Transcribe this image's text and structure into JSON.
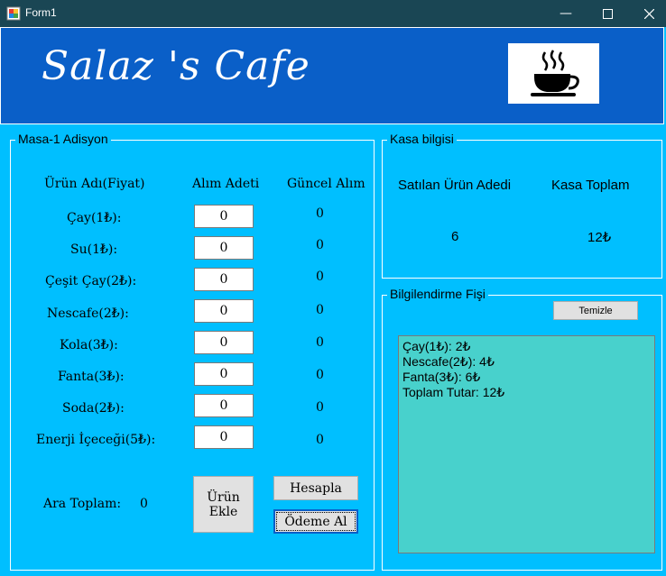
{
  "window": {
    "title": "Form1"
  },
  "header": {
    "brand": "Salaz 's Cafe"
  },
  "order": {
    "group_title": "Masa-1 Adisyon",
    "headers": {
      "product": "Ürün Adı(Fiyat)",
      "qty": "Alım Adeti",
      "current": "Güncel Alım"
    },
    "items": [
      {
        "name": "Çay(1₺):",
        "qty": "0",
        "current": "0"
      },
      {
        "name": "Su(1₺):",
        "qty": "0",
        "current": "0"
      },
      {
        "name": "Çeşit Çay(2₺):",
        "qty": "0",
        "current": "0"
      },
      {
        "name": "Nescafe(2₺):",
        "qty": "0",
        "current": "0"
      },
      {
        "name": "Kola(3₺):",
        "qty": "0",
        "current": "0"
      },
      {
        "name": "Fanta(3₺):",
        "qty": "0",
        "current": "0"
      },
      {
        "name": "Soda(2₺):",
        "qty": "0",
        "current": "0"
      },
      {
        "name": "Enerji İçeceği(5₺):",
        "qty": "0",
        "current": "0"
      }
    ],
    "subtotal_label": "Ara Toplam:",
    "subtotal_value": "0",
    "add_button": "Ürün Ekle",
    "calc_button": "Hesapla",
    "pay_button": "Ödeme Al"
  },
  "register": {
    "group_title": "Kasa bilgisi",
    "sold_label": "Satılan Ürün Adedi",
    "total_label": "Kasa Toplam",
    "sold_value": "6",
    "total_value": "12₺"
  },
  "receipt": {
    "group_title": "Bilgilendirme Fişi",
    "clear_button": "Temizle",
    "lines": [
      "Çay(1₺): 2₺",
      "Nescafe(2₺): 4₺",
      "Fanta(3₺): 6₺",
      "Toplam Tutar: 12₺"
    ]
  }
}
